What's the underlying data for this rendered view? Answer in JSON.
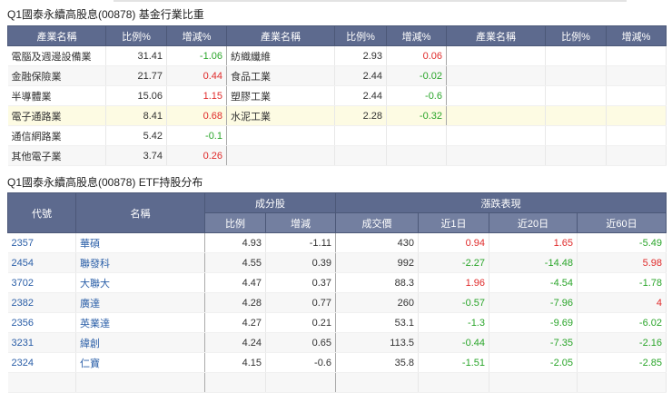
{
  "industry": {
    "title": "Q1國泰永續高股息(00878) 基金行業比重",
    "headers": [
      "產業名稱",
      "比例%",
      "增減%"
    ],
    "rows": [
      [
        {
          "name": "電腦及週邊設備業",
          "pct": "31.41",
          "chg": "-1.06"
        },
        {
          "name": "紡織纖維",
          "pct": "2.93",
          "chg": "0.06"
        }
      ],
      [
        {
          "name": "金融保險業",
          "pct": "21.77",
          "chg": "0.44"
        },
        {
          "name": "食品工業",
          "pct": "2.44",
          "chg": "-0.02"
        }
      ],
      [
        {
          "name": "半導體業",
          "pct": "15.06",
          "chg": "1.15"
        },
        {
          "name": "塑膠工業",
          "pct": "2.44",
          "chg": "-0.6"
        }
      ],
      [
        {
          "name": "電子通路業",
          "pct": "8.41",
          "chg": "0.68"
        },
        {
          "name": "水泥工業",
          "pct": "2.28",
          "chg": "-0.32"
        }
      ],
      [
        {
          "name": "通信網路業",
          "pct": "5.42",
          "chg": "-0.1"
        },
        null
      ],
      [
        {
          "name": "其他電子業",
          "pct": "3.74",
          "chg": "0.26"
        },
        null
      ]
    ]
  },
  "holdings": {
    "title": "Q1國泰永續高股息(00878) ETF持股分布",
    "headers": {
      "code": "代號",
      "name": "名稱",
      "group1": "成分股",
      "group2": "漲跌表現",
      "ratio": "比例",
      "change": "增減",
      "price": "成交價",
      "d1": "近1日",
      "d20": "近20日",
      "d60": "近60日"
    },
    "rows": [
      {
        "code": "2357",
        "name": "華碩",
        "ratio": "4.93",
        "change": "-1.11",
        "price": "430",
        "d1": "0.94",
        "d20": "1.65",
        "d60": "-5.49"
      },
      {
        "code": "2454",
        "name": "聯發科",
        "ratio": "4.55",
        "change": "0.39",
        "price": "992",
        "d1": "-2.27",
        "d20": "-14.48",
        "d60": "5.98"
      },
      {
        "code": "3702",
        "name": "大聯大",
        "ratio": "4.47",
        "change": "0.37",
        "price": "88.3",
        "d1": "1.96",
        "d20": "-4.54",
        "d60": "-1.78"
      },
      {
        "code": "2382",
        "name": "廣達",
        "ratio": "4.28",
        "change": "0.77",
        "price": "260",
        "d1": "-0.57",
        "d20": "-7.96",
        "d60": "4"
      },
      {
        "code": "2356",
        "name": "英業達",
        "ratio": "4.27",
        "change": "0.21",
        "price": "53.1",
        "d1": "-1.3",
        "d20": "-9.69",
        "d60": "-6.02"
      },
      {
        "code": "3231",
        "name": "緯創",
        "ratio": "4.24",
        "change": "0.65",
        "price": "113.5",
        "d1": "-0.44",
        "d20": "-7.35",
        "d60": "-2.16"
      },
      {
        "code": "2324",
        "name": "仁寶",
        "ratio": "4.15",
        "change": "-0.6",
        "price": "35.8",
        "d1": "-1.51",
        "d20": "-2.05",
        "d60": "-2.85"
      }
    ]
  },
  "colors": {
    "up": "#e02b2b",
    "down": "#2aa52a",
    "header": "#5d6a8e"
  }
}
